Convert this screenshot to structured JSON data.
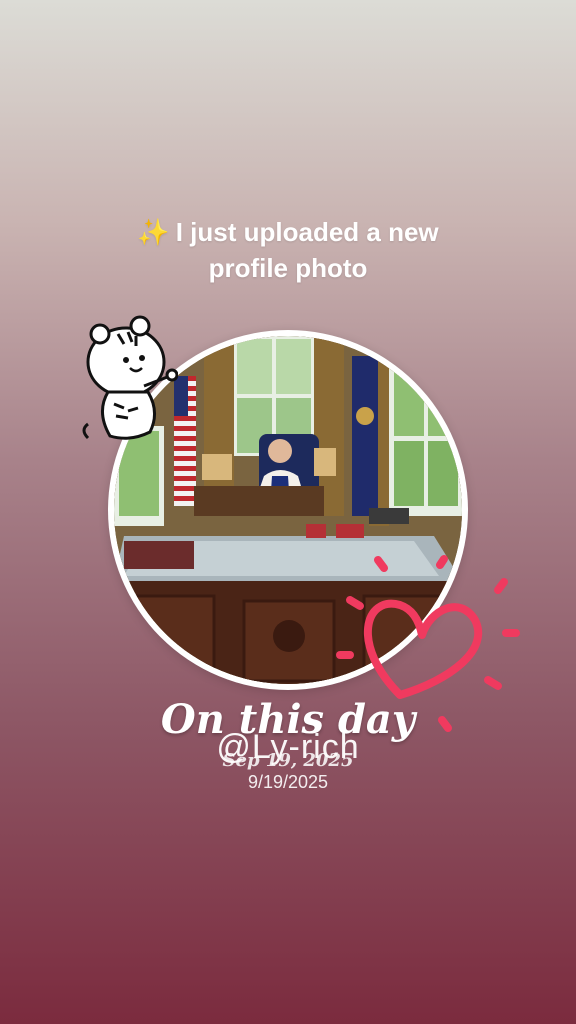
{
  "headline": {
    "sparkle": "✨",
    "line1": "I just uploaded a new",
    "line2": "profile photo"
  },
  "caption": {
    "title": "On this day",
    "handle": "@Ly-rich",
    "date_script": "Sep 19, 2025",
    "date_plain": "9/19/2025"
  },
  "stickers": {
    "tiger": "tiger-sticker",
    "heart": "heart-sticker"
  },
  "colors": {
    "heart": "#f03a5f",
    "text": "#ffffff",
    "gradient_top": "#dcdcd6",
    "gradient_bottom": "#7b2b3e"
  }
}
